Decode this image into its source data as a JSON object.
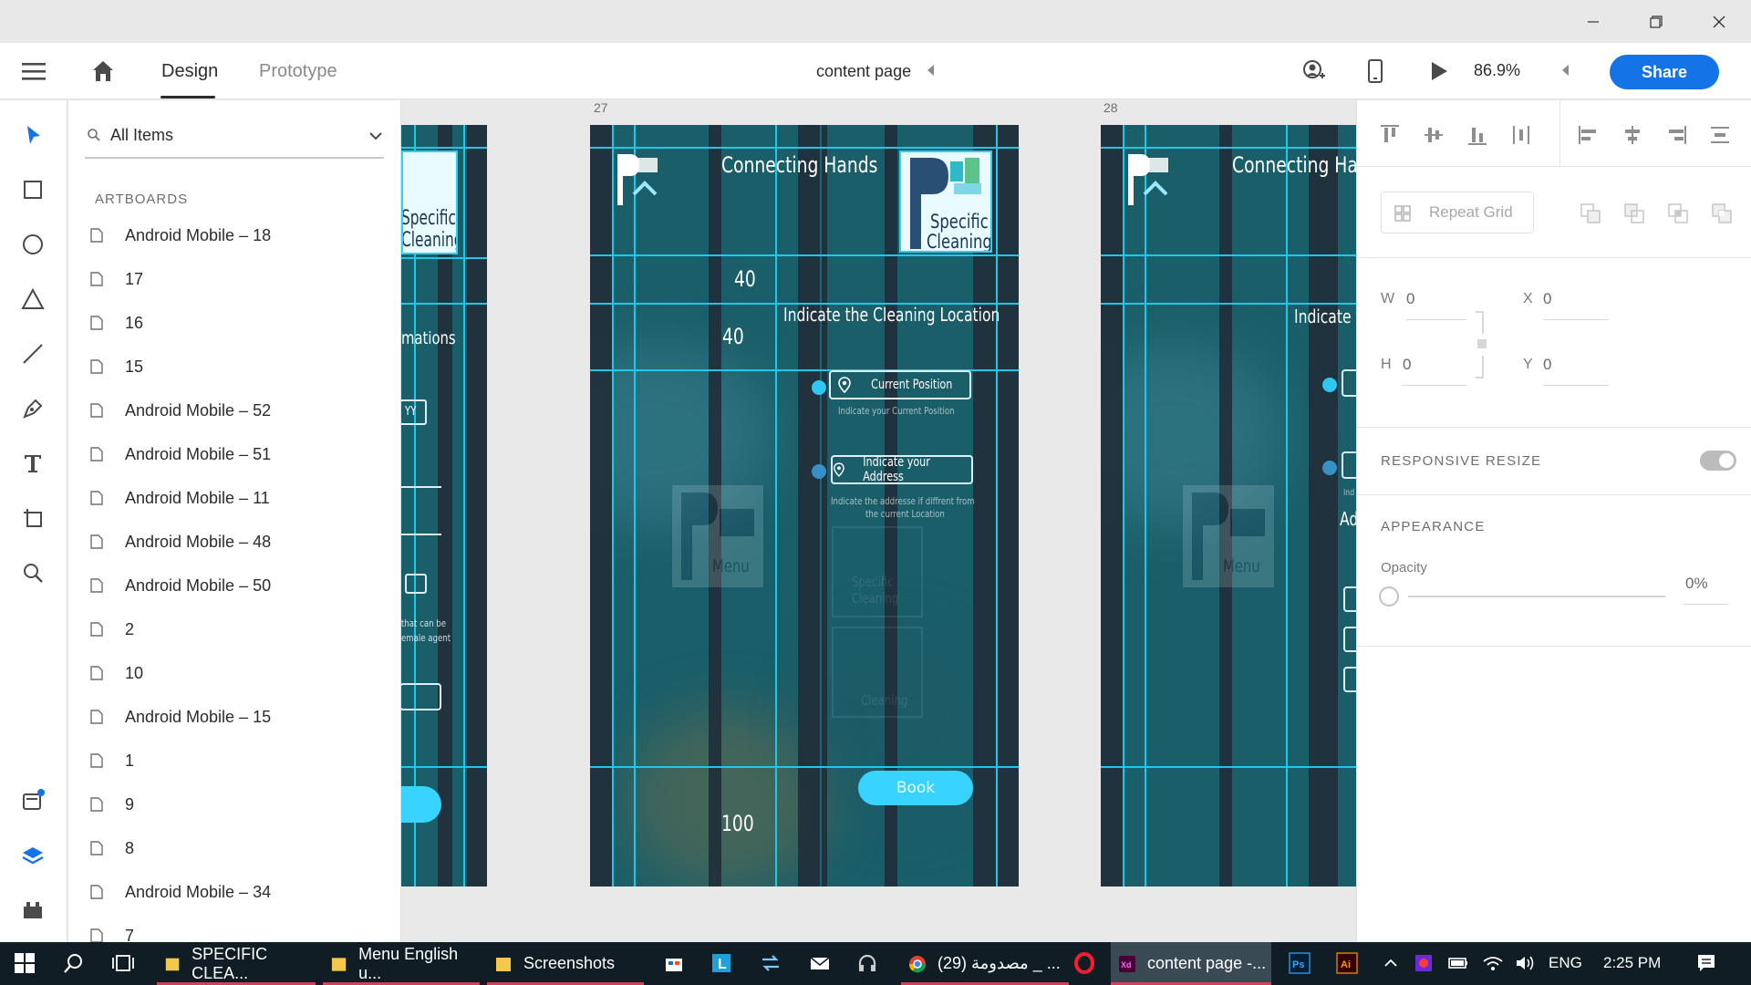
{
  "window": {
    "controls": [
      "minimize",
      "restore",
      "close"
    ]
  },
  "header": {
    "tabs": [
      {
        "label": "Design",
        "active": true
      },
      {
        "label": "Prototype",
        "active": false
      }
    ],
    "document_title": "content page",
    "zoom": "86.9%",
    "share_label": "Share",
    "accent_color": "#1473e6"
  },
  "toolbar": {
    "tools": [
      "select-arrow-icon",
      "rectangle-icon",
      "ellipse-icon",
      "triangle-icon",
      "line-icon",
      "pen-icon",
      "text-icon",
      "artboard-icon",
      "zoom-icon"
    ],
    "bottom": [
      "assets-icon",
      "layers-icon",
      "plugins-icon"
    ]
  },
  "layers": {
    "filter_label": "All Items",
    "section_label": "ARTBOARDS",
    "artboards": [
      "Android Mobile – 18",
      "17",
      "16",
      "15",
      "Android Mobile – 52",
      "Android Mobile – 51",
      "Android Mobile – 11",
      "Android Mobile – 48",
      "Android Mobile – 50",
      "2",
      "10",
      "Android Mobile – 15",
      "1",
      "9",
      "8",
      "Android Mobile – 34",
      "7"
    ]
  },
  "canvas": {
    "artboard_numbers": [
      "27",
      "28"
    ],
    "left_partial": {
      "logo_text_1": "Specific",
      "logo_text_2": "Cleaning",
      "fragment_1": "mations",
      "fragment_2": "YY",
      "fragment_3": "that can be",
      "fragment_4": "emale agent"
    },
    "main": {
      "title": "Connecting Hands",
      "logo_text_1": "Specific",
      "logo_text_2": "Cleaning",
      "spacing_1": "40",
      "spacing_2": "40",
      "heading": "Indicate the Cleaning Location",
      "option_1": "Current Position",
      "option_1_hint": "Indicate  your  Current Position",
      "option_2": "Indicate your Address",
      "option_2_hint_1": "Indicate the  addresse if diffrent from",
      "option_2_hint_2": "the current  Location",
      "menu_label": "Menu",
      "ghost_1": "Specific",
      "ghost_2": "Cleaning",
      "ghost_3": "Cleaning",
      "book_label": "Book",
      "spacing_3": "100"
    },
    "right_partial": {
      "title": "Connecting Hand",
      "heading": "Indicate t",
      "menu_label": "Menu",
      "fragment": "Addre",
      "fragment_2": "Ind"
    }
  },
  "inspector": {
    "repeat_grid_label": "Repeat Grid",
    "w_label": "W",
    "w_value": "0",
    "h_label": "H",
    "h_value": "0",
    "x_label": "X",
    "x_value": "0",
    "y_label": "Y",
    "y_value": "0",
    "responsive_resize_label": "RESPONSIVE RESIZE",
    "appearance_label": "APPEARANCE",
    "opacity_label": "Opacity",
    "opacity_value": "0%"
  },
  "taskbar": {
    "apps": [
      {
        "label": "SPECIFIC CLEA...",
        "icon": "folder-icon",
        "active": false
      },
      {
        "label": "Menu English u...",
        "icon": "folder-icon",
        "active": false
      },
      {
        "label": "Screenshots",
        "icon": "folder-icon",
        "active": false
      },
      {
        "label": "(29) مصدومة _ ...",
        "icon": "chrome-icon",
        "active": false
      },
      {
        "label": "content page -...",
        "icon": "xd-icon",
        "active": true
      }
    ],
    "language": "ENG",
    "time": "2:25 PM"
  }
}
